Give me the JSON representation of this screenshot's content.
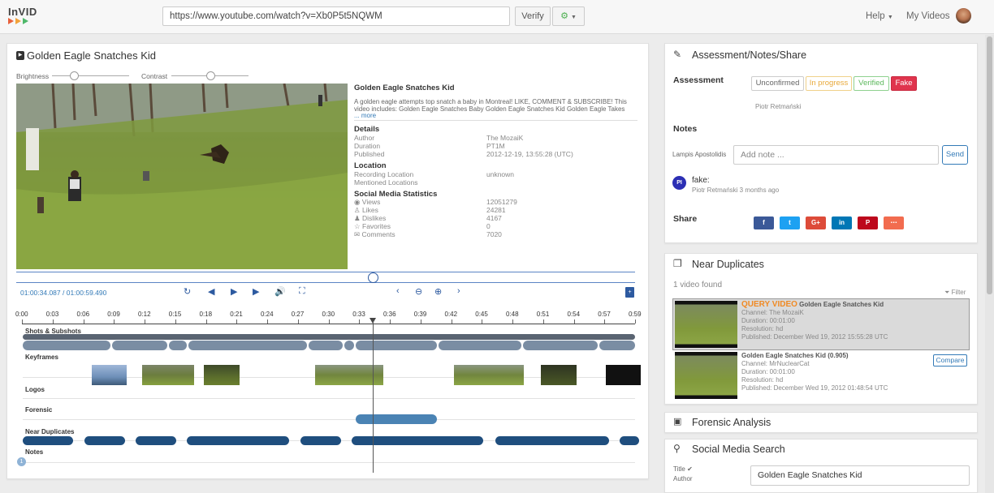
{
  "topbar": {
    "logo": "InVID",
    "url": "https://www.youtube.com/watch?v=Xb0P5t5NQWM",
    "verify": "Verify",
    "help": "Help",
    "my_videos": "My Videos"
  },
  "video": {
    "panel_title": "Golden Eagle Snatches Kid",
    "brightness": "Brightness",
    "contrast": "Contrast",
    "info_title": "Golden Eagle Snatches Kid",
    "description": "A golden eagle attempts top snatch a baby in Montreal! LIKE, COMMENT & SUBSCRIBE! This video includes: Golden Eagle Snatches Baby Golden Eagle Snatches Kid Golden Eagle Takes Baby Golde",
    "more": "... more",
    "details_h": "Details",
    "details": [
      [
        "Author",
        "The MozaiK"
      ],
      [
        "Duration",
        "PT1M"
      ],
      [
        "Published",
        "2012-12-19, 13:55:28 (UTC)"
      ]
    ],
    "location_h": "Location",
    "location": [
      [
        "Recording Location",
        "unknown"
      ],
      [
        "Mentioned Locations",
        ""
      ]
    ],
    "social_h": "Social Media Statistics",
    "social": [
      [
        "Views",
        "12051279"
      ],
      [
        "Likes",
        "24281"
      ],
      [
        "Dislikes",
        "4167"
      ],
      [
        "Favorites",
        "0"
      ],
      [
        "Comments",
        "7020"
      ]
    ],
    "time": "01:00:34.087 / 01:00:59.490",
    "progress": 0.58
  },
  "timeline": {
    "ticks": [
      "0:00",
      "0:03",
      "0:06",
      "0:09",
      "0:12",
      "0:15",
      "0:18",
      "0:21",
      "0:24",
      "0:27",
      "0:30",
      "0:33",
      "0:36",
      "0:39",
      "0:42",
      "0:45",
      "0:48",
      "0:51",
      "0:54",
      "0:57",
      "0:59"
    ],
    "rows": [
      "Shots & Subshots",
      "Keyframes",
      "Logos",
      "Forensic",
      "Near Duplicates",
      "Notes"
    ],
    "notes_count": "1"
  },
  "assessment": {
    "title": "Assessment/Notes/Share",
    "label": "Assessment",
    "options": [
      "Unconfirmed",
      "In progress",
      "Verified",
      "Fake"
    ],
    "by": "Piotr Retmański",
    "notes_label": "Notes",
    "note_user": "Lampis Apostolidis",
    "note_placeholder": "Add note ...",
    "send": "Send",
    "note_avatar": "PI",
    "note_text": "fake:",
    "note_meta": "Piotr Retmański 3 months ago",
    "share_label": "Share",
    "share_buttons": [
      "f",
      "t",
      "G+",
      "in",
      "P",
      "⋯"
    ],
    "share_colors": [
      "#3b5998",
      "#1da1f2",
      "#dd4b39",
      "#0077b5",
      "#bd081c",
      "#f26c4f"
    ]
  },
  "duplicates": {
    "title": "Near Duplicates",
    "found": "1 video found",
    "filter": "Filter",
    "query_tag": "QUERY VIDEO",
    "items": [
      {
        "title": "Golden Eagle Snatches Kid",
        "channel": "Channel: The MozaiK",
        "duration": "Duration: 00:01:00",
        "resolution": "Resolution: hd",
        "published": "Published: December Wed 19, 2012 15:55:28 UTC"
      },
      {
        "title": "Golden Eagle Snatches Kid (0.905)",
        "channel": "Channel: MrNuclearCat",
        "duration": "Duration: 00:01:00",
        "resolution": "Resolution: hd",
        "published": "Published: December Wed 19, 2012 01:48:54 UTC",
        "compare": "Compare"
      }
    ]
  },
  "forensic": {
    "title": "Forensic Analysis"
  },
  "social": {
    "title": "Social Media Search",
    "title_label": "Title",
    "author_label": "Author",
    "value": "Golden Eagle Snatches Kid"
  }
}
